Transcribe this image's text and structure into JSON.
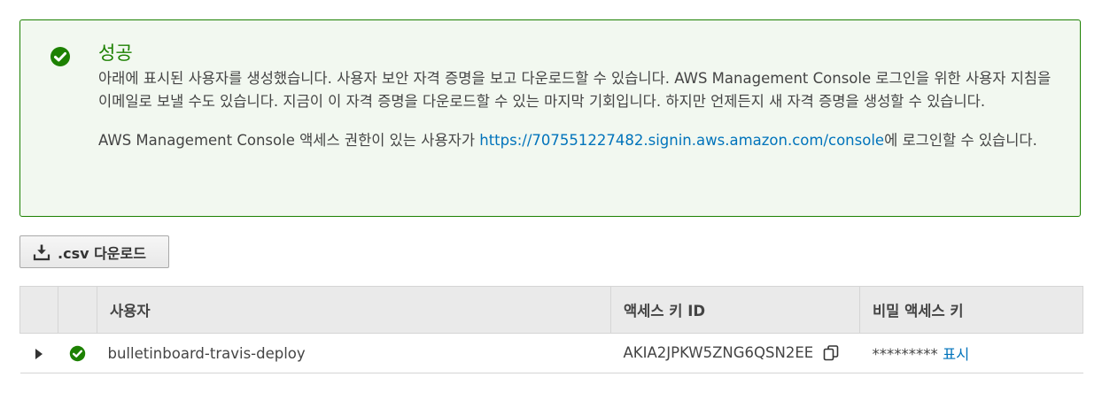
{
  "alert": {
    "title": "성공",
    "icon": "check-circle-icon",
    "color": "#1d8102",
    "message": "아래에 표시된 사용자를 생성했습니다. 사용자 보안 자격 증명을 보고 다운로드할 수 있습니다. AWS Management Console 로그인을 위한 사용자 지침을 이메일로 보낼 수도 있습니다. 지금이 이 자격 증명을 다운로드할 수 있는 마지막 기회입니다. 하지만 언제든지 새 자격 증명을 생성할 수 있습니다.",
    "console_prefix": "AWS Management Console 액세스 권한이 있는 사용자가 ",
    "console_link": "https://707551227482.signin.aws.amazon.com/console",
    "console_suffix": "에 로그인할 수 있습니다."
  },
  "download_button": {
    "label": ".csv 다운로드",
    "icon": "download-icon"
  },
  "table": {
    "headers": [
      "",
      "",
      "사용자",
      "액세스 키 ID",
      "비밀 액세스 키"
    ],
    "rows": [
      {
        "user": "bulletinboard-travis-deploy",
        "access_key_id": "AKIA2JPKW5ZNG6QSN2EE",
        "secret_masked": "*********",
        "show_label": "표시"
      }
    ]
  },
  "colors": {
    "success": "#1d8102",
    "link": "#0073bb"
  }
}
